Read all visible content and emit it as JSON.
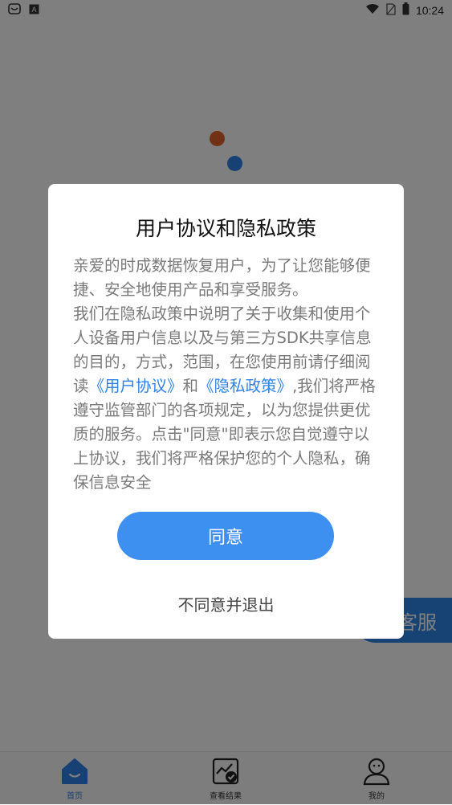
{
  "status_bar": {
    "time": "10:24",
    "left_icons": [
      "app-notification-icon",
      "letter-a-icon"
    ],
    "right_icons": [
      "wifi-icon",
      "no-sim-icon",
      "battery-icon"
    ]
  },
  "floating": {
    "service_label": "客服"
  },
  "bottom_nav": {
    "items": [
      {
        "label": "首页",
        "icon": "home-icon",
        "active": true
      },
      {
        "label": "查看结果",
        "icon": "chart-check-icon",
        "active": false
      },
      {
        "label": "我的",
        "icon": "user-icon",
        "active": false
      }
    ]
  },
  "dialog": {
    "title": "用户协议和隐私政策",
    "paragraph1": "亲爱的时成数据恢复用户，为了让您能够便捷、安全地使用产品和享受服务。",
    "paragraph2_pre": "我们在隐私政策中说明了关于收集和使用个人设备用户信息以及与第三方SDK共享信息的目的，方式，范围，在您使用前请仔细阅读",
    "link_user_agreement": "《用户协议》",
    "and_word": "和",
    "link_privacy_policy": "《隐私政策》",
    "paragraph2_post": ",我们将严格遵守监管部门的各项规定，以为您提供更优质的服务。点击\"同意\"即表示您自觉遵守以上协议，我们将严格保护您的个人隐私，确保信息安全",
    "agree_label": "同意",
    "disagree_label": "不同意并退出"
  },
  "colors": {
    "accent": "#3d8ff0",
    "link": "#2f80e8",
    "dot_orange": "#e2622a",
    "dot_blue": "#2f80e8",
    "overlay": "rgba(0,0,0,0.5)"
  }
}
